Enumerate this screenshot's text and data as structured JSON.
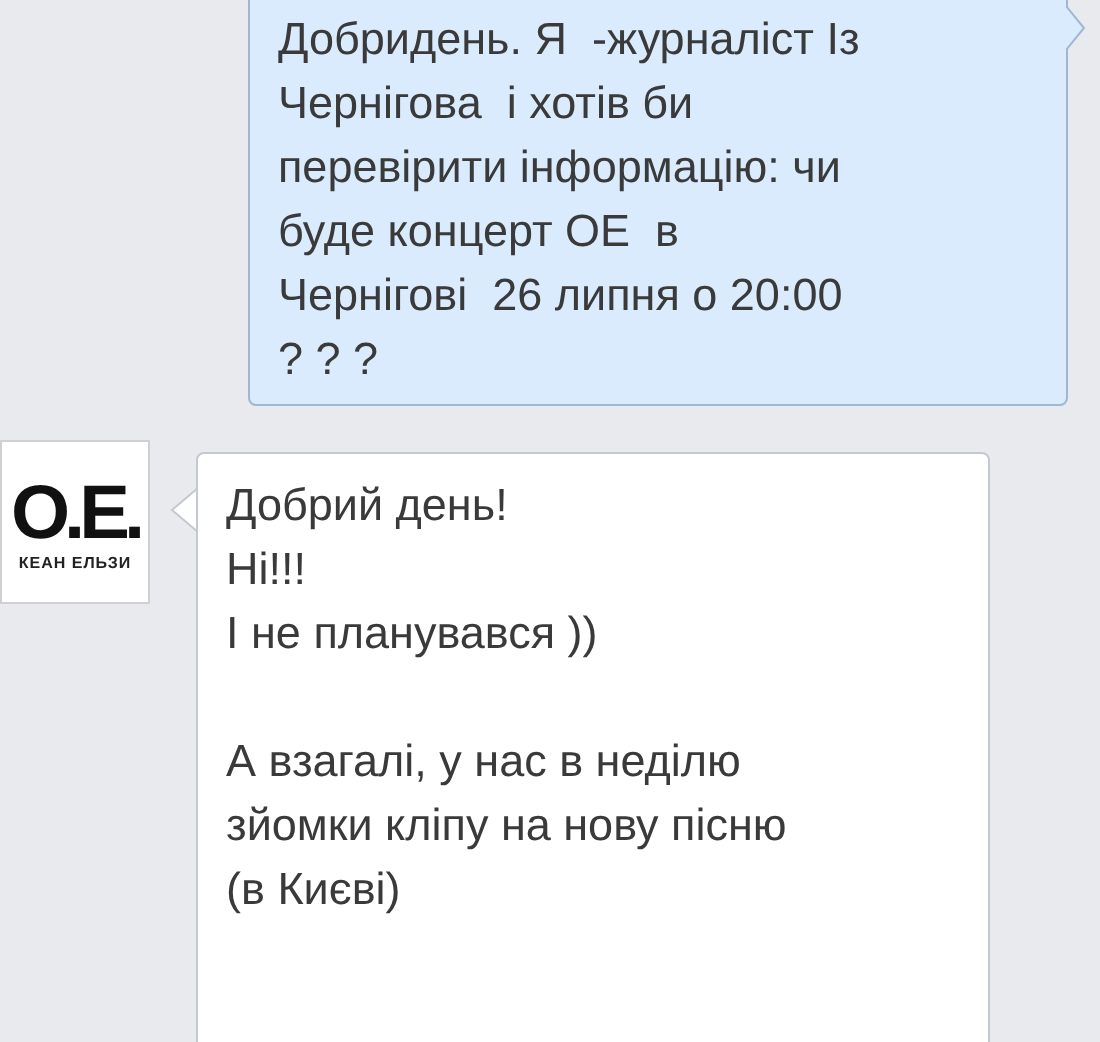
{
  "messages": [
    {
      "kind": "outgoing",
      "paragraphs": [
        "Добридень. Я  -журналіст Із\nЧернігова  і хотів би\nперевірити інформацію: чи\nбуде концерт ОЕ  в\nЧернігові  26 липня о 20:00\n? ? ?"
      ]
    },
    {
      "kind": "incoming",
      "avatar": {
        "logo": "O.E.",
        "caption": "КЕАН ЕЛЬЗИ"
      },
      "paragraphs": [
        "Добрий день!\nНі!!!\nІ не планувався ))",
        "А взагалі, у нас в неділю\nзйомки кліпу на нову пісню\n(в Києві)"
      ]
    }
  ]
}
